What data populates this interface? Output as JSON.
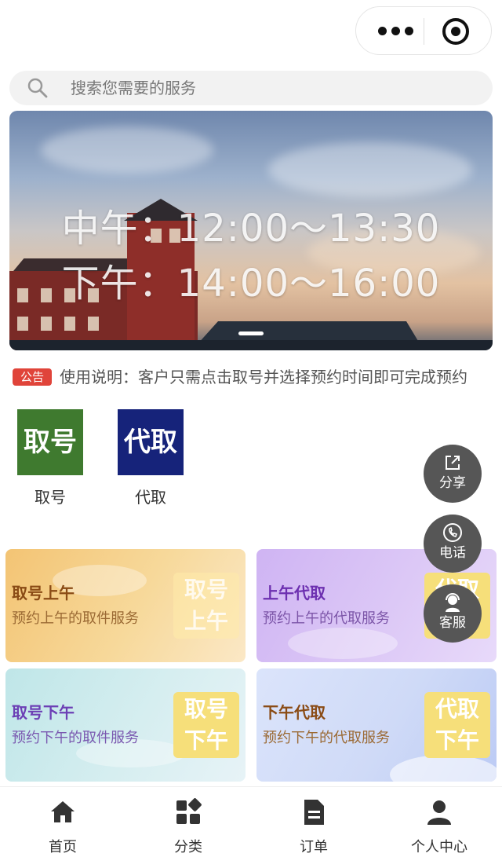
{
  "capsule": {
    "more_icon": "more-dots-icon",
    "close_icon": "target-circle-icon"
  },
  "search": {
    "placeholder": "搜索您需要的服务",
    "icon": "search-icon"
  },
  "banner": {
    "line1": "中午：12:00～13:30",
    "line2": "下午：14:00～16:00",
    "slide_count": 1
  },
  "notice": {
    "tag": "公告",
    "text": "使用说明：客户只需点击取号并选择预约时间即可完成预约"
  },
  "quick_entries": [
    {
      "tile_text": "取号",
      "label": "取号",
      "color": "#3f7a2f"
    },
    {
      "tile_text": "代取",
      "label": "代取",
      "color": "#16237a"
    }
  ],
  "cards": [
    {
      "title": "取号上午",
      "subtitle": "预约上午的取件服务",
      "badge_line1": "取号",
      "badge_line2": "上午"
    },
    {
      "title": "上午代取",
      "subtitle": "预约上午的代取服务",
      "badge_line1": "代取",
      "badge_line2": "上午"
    },
    {
      "title": "取号下午",
      "subtitle": "预约下午的取件服务",
      "badge_line1": "取号",
      "badge_line2": "下午"
    },
    {
      "title": "下午代取",
      "subtitle": "预约下午的代取服务",
      "badge_line1": "代取",
      "badge_line2": "下午"
    }
  ],
  "floating_buttons": [
    {
      "label": "分享",
      "icon": "share-icon"
    },
    {
      "label": "电话",
      "icon": "phone-icon"
    },
    {
      "label": "客服",
      "icon": "customer-service-icon"
    }
  ],
  "tabbar": [
    {
      "label": "首页",
      "icon": "home-icon"
    },
    {
      "label": "分类",
      "icon": "category-icon"
    },
    {
      "label": "订单",
      "icon": "order-icon"
    },
    {
      "label": "个人中心",
      "icon": "user-icon"
    }
  ],
  "colors": {
    "notice_tag": "#e0443a",
    "fab_bg": "#565656",
    "badge_yellow": "#f6df7a"
  }
}
